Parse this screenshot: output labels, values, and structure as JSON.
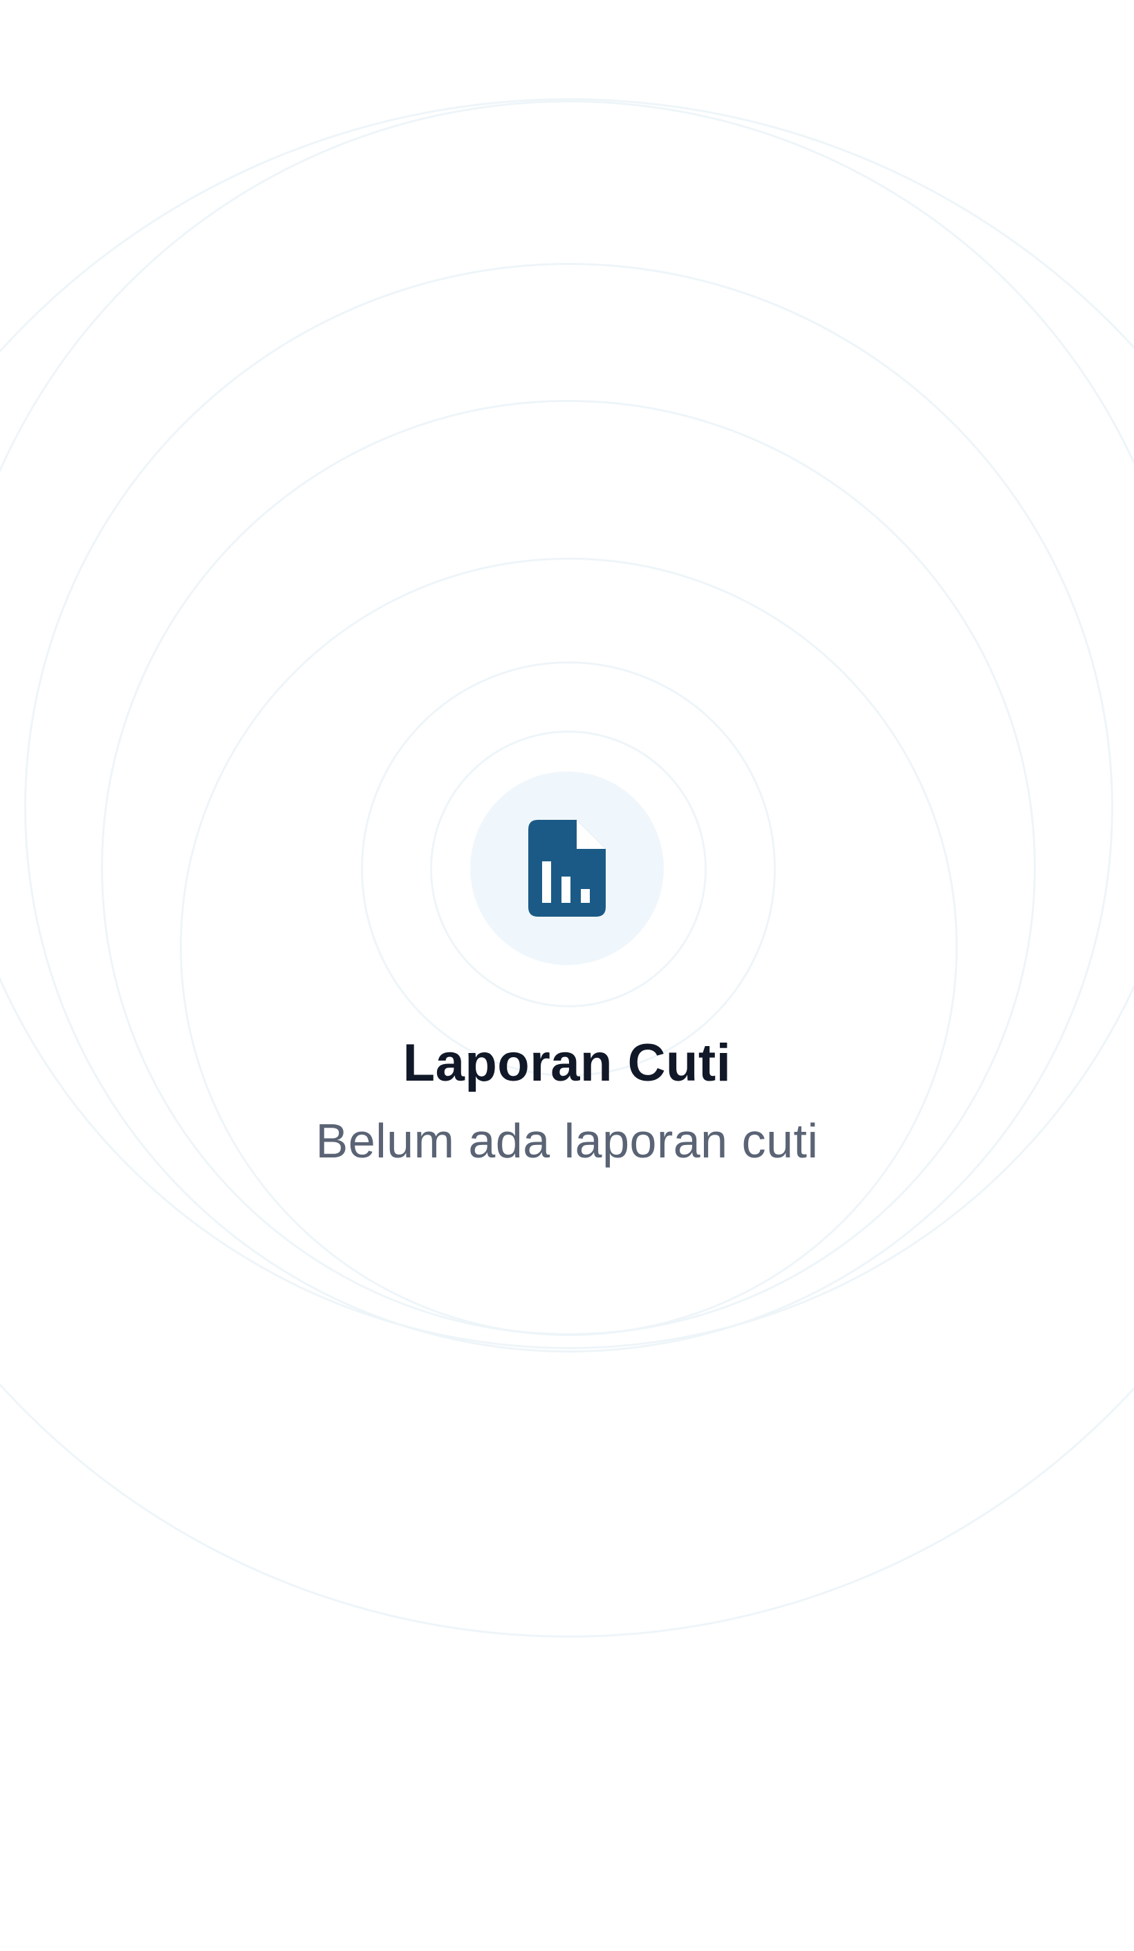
{
  "empty_state": {
    "icon": "report-document-chart-icon",
    "title": "Laporan Cuti",
    "message": "Belum ada laporan cuti"
  },
  "colors": {
    "icon_color": "#1b5a86",
    "icon_background": "#f0f7fc",
    "ring_color": "#eef5f9",
    "title_color": "#111827",
    "message_color": "#5b6475",
    "background": "#ffffff"
  }
}
